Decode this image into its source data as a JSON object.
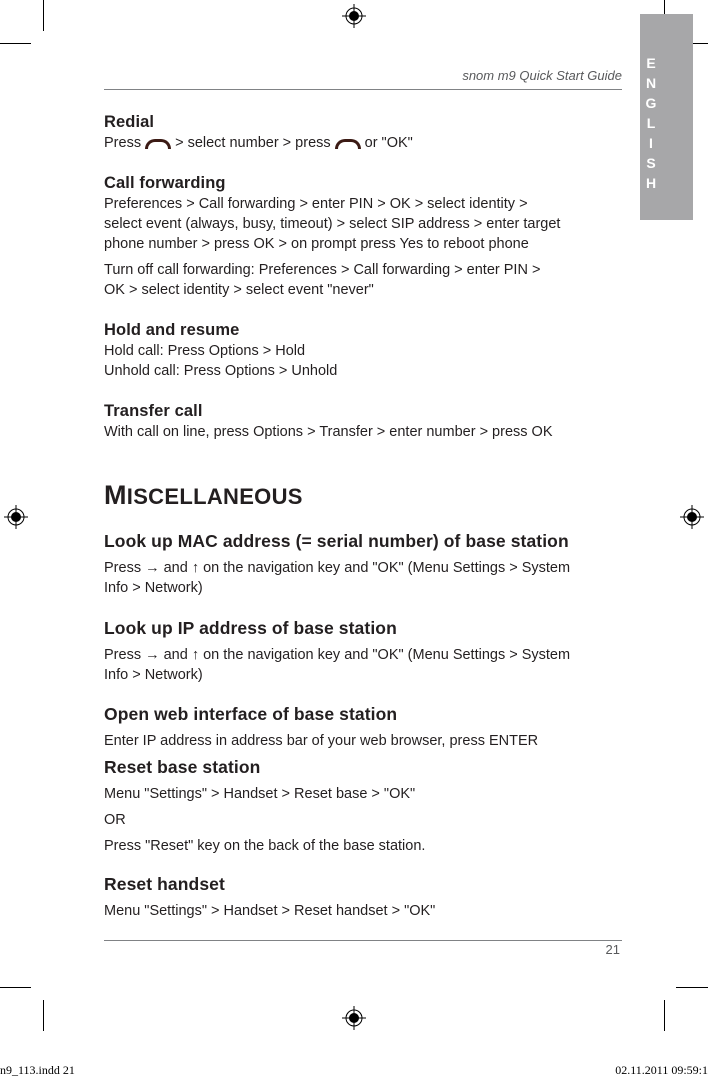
{
  "header": {
    "guide_title": "snom m9 Quick Start Guide"
  },
  "language_tab": {
    "letters": [
      "E",
      "N",
      "G",
      "L",
      "I",
      "S",
      "H"
    ]
  },
  "sections": {
    "redial": {
      "title": "Redial",
      "line": {
        "press": "Press",
        "middle": "> select number  > press",
        "end": "or \"OK\""
      },
      "key_icon": "call-key-icon"
    },
    "call_forwarding": {
      "title": "Call forwarding",
      "lines": [
        "Preferences > Call forwarding > enter PIN > OK > select identity >",
        "select event (always, busy, timeout) > select SIP address > enter target",
        "phone number > press OK > on prompt press Yes to reboot phone"
      ],
      "off_lines": [
        "Turn off call forwarding:  Preferences > Call forwarding > enter PIN >",
        "OK > select identity > select event \"never\""
      ]
    },
    "hold_resume": {
      "title": "Hold and resume",
      "lines": [
        "Hold call:  Press Options > Hold",
        "Unhold call:  Press Options > Unhold"
      ]
    },
    "transfer": {
      "title": "Transfer call",
      "lines": [
        "With call on line, press Options > Transfer > enter number > press OK"
      ]
    }
  },
  "misc": {
    "heading_first": "M",
    "heading_rest": "ISCELLANEOUS",
    "items": [
      {
        "title": "Look up MAC address (= serial number) of base station",
        "lines": [
          "Press → and ↑ on the navigation key and \"OK\" (Menu Settings > System",
          "Info > Network)"
        ]
      },
      {
        "title": "Look up IP address of base station",
        "lines": [
          "Press → and ↑ on the navigation key and \"OK\" (Menu Settings > System",
          "Info > Network)"
        ]
      },
      {
        "title": "Open web interface of base station",
        "lines": [
          "Enter IP address in address bar of your web browser, press ENTER"
        ]
      },
      {
        "title": "Reset base station",
        "lines": [
          "Menu \"Settings\"  >  Handset  >  Reset base >  \"OK\"",
          "OR",
          "Press \"Reset\" key on the back of the base station."
        ]
      },
      {
        "title": "Reset handset",
        "lines": [
          "Menu \"Settings\"  >  Handset  >  Reset handset >  \"OK\""
        ]
      }
    ]
  },
  "footer": {
    "page_number": "21",
    "slug_left": "n9_113.indd   21",
    "slug_right": "02.11.2011   09:59:1"
  },
  "colors": {
    "tab_gray": "#a7a7a9",
    "text": "#231f20",
    "key_brown": "#3b1a14"
  }
}
